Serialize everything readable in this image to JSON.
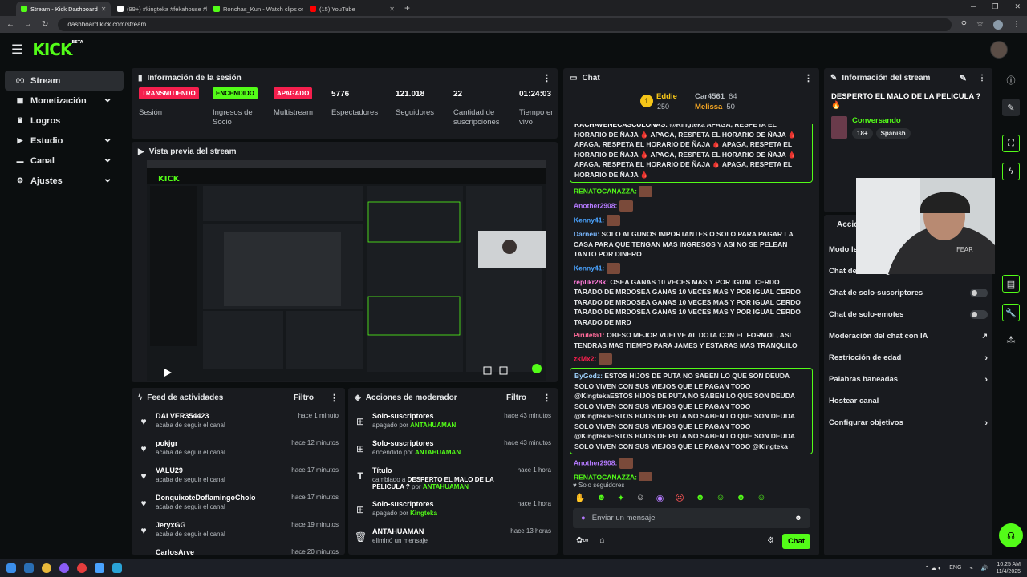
{
  "browser": {
    "tabs": [
      {
        "title": "Stream - Kick Dashboard",
        "color": "#53fc18",
        "active": true
      },
      {
        "title": "(99+) #kingteka #fekahouse #lo",
        "color": "#ffffff",
        "active": false
      },
      {
        "title": "Ronchas_Kun - Watch clips on",
        "color": "#53fc18",
        "active": false
      },
      {
        "title": "(15) YouTube",
        "color": "#ff0000",
        "active": false
      }
    ],
    "url": "dashboard.kick.com/stream"
  },
  "header": {
    "logo": "KICK",
    "logo_badge": "BETA"
  },
  "sidebar": {
    "items": [
      {
        "label": "Stream",
        "icon": "stream-icon",
        "active": true,
        "chevron": false
      },
      {
        "label": "Monetización",
        "icon": "wallet-icon",
        "chevron": true
      },
      {
        "label": "Logros",
        "icon": "trophy-icon",
        "chevron": false
      },
      {
        "label": "Estudio",
        "icon": "studio-icon",
        "chevron": true
      },
      {
        "label": "Canal",
        "icon": "channel-icon",
        "chevron": true
      },
      {
        "label": "Ajustes",
        "icon": "gear-icon",
        "chevron": true
      }
    ]
  },
  "session": {
    "title": "Información de la sesión",
    "stats": [
      {
        "value": "TRANSMITIENDO",
        "label": "Sesión",
        "badge": true,
        "bg": "#f51f4d",
        "fg": "#ffffff"
      },
      {
        "value": "ENCENDIDO",
        "label": "Ingresos de Socio",
        "badge": true,
        "bg": "#53fc18",
        "fg": "#000000"
      },
      {
        "value": "APAGADO",
        "label": "Multistream",
        "badge": true,
        "bg": "#f51f4d",
        "fg": "#ffffff"
      },
      {
        "value": "5776",
        "label": "Espectadores"
      },
      {
        "value": "121.018",
        "label": "Seguidores"
      },
      {
        "value": "22",
        "label": "Cantidad de suscripciones"
      },
      {
        "value": "01:24:03",
        "label": "Tiempo en vivo"
      }
    ]
  },
  "preview": {
    "title": "Vista previa del stream"
  },
  "activity": {
    "title": "Feed de actividades",
    "filter": "Filtro",
    "items": [
      {
        "name": "DALVER354423",
        "action": "acaba de seguir el canal",
        "time": "hace 1 minuto"
      },
      {
        "name": "pokjgr",
        "action": "acaba de seguir el canal",
        "time": "hace 12 minutos"
      },
      {
        "name": "VALU29",
        "action": "acaba de seguir el canal",
        "time": "hace 17 minutos"
      },
      {
        "name": "DonquixoteDoflamingoCholo",
        "action": "acaba de seguir el canal",
        "time": "hace 17 minutos"
      },
      {
        "name": "JeryxGG",
        "action": "acaba de seguir el canal",
        "time": "hace 19 minutos"
      },
      {
        "name": "CarlosArve",
        "action": "",
        "time": "hace 20 minutos"
      }
    ]
  },
  "mod_actions": {
    "title": "Acciones de moderador",
    "filter": "Filtro",
    "items": [
      {
        "icon": "gift-icon",
        "title": "Solo-suscriptores",
        "pre": "apagado por ",
        "user": "ANTAHUAMAN",
        "time": "hace 43 minutos"
      },
      {
        "icon": "gift-icon",
        "title": "Solo-suscriptores",
        "pre": "encendido por ",
        "user": "ANTAHUAMAN",
        "time": "hace 43 minutos"
      },
      {
        "icon": "title-icon",
        "title": "Título",
        "pre": "cambiado a ",
        "bold": "DESPERTO EL MALO DE LA PELICULA ?",
        "post": " por ",
        "user": "ANTAHUAMAN",
        "time": "hace 1 hora"
      },
      {
        "icon": "gift-icon",
        "title": "Solo-suscriptores",
        "pre": "apagado por ",
        "user": "Kingteka",
        "time": "hace 1 hora"
      },
      {
        "icon": "trash-icon",
        "title": "ANTAHUAMAN",
        "pre": "eliminó un mensaje",
        "user": "",
        "time": "hace 13 horas"
      }
    ]
  },
  "chat": {
    "title": "Chat",
    "gifters": [
      {
        "name": "Eddie",
        "count": "250",
        "color": "#f5c518"
      },
      {
        "name": "Car4561",
        "count": "64",
        "color": "#b7bcc1"
      },
      {
        "name": "Melissa",
        "count": "50",
        "color": "#f5a623"
      }
    ],
    "messages": [
      {
        "user": "KACHAVENECASCULONAS:",
        "color": "#ffffff",
        "text": "@Kingteka APAGA, RESPETA EL HORARIO DE ÑAJA 🩸 APAGA, RESPETA EL HORARIO DE ÑAJA 🩸 APAGA, RESPETA EL HORARIO DE ÑAJA 🩸 APAGA, RESPETA EL HORARIO DE ÑAJA 🩸 APAGA, RESPETA EL HORARIO DE ÑAJA 🩸 APAGA, RESPETA EL HORARIO DE ÑAJA 🩸 APAGA, RESPETA EL HORARIO DE ÑAJA 🩸",
        "highlight": true,
        "cut_top": true
      },
      {
        "user": "RENATOCANAZZA:",
        "color": "#53fc18",
        "text": "",
        "emote": true
      },
      {
        "user": "Another2908:",
        "color": "#b57aff",
        "text": "",
        "emote": true
      },
      {
        "user": "Kenny41:",
        "color": "#4aa3ff",
        "text": "",
        "emote": true
      },
      {
        "user": "Darneu:",
        "color": "#7ab8ff",
        "text": "SOLO ALGUNOS IMPORTANTES O SOLO PARA PAGAR LA CASA PARA QUE TENGAN MAS INGRESOS Y ASI NO SE PELEAN TANTO POR DINERO"
      },
      {
        "user": "Kenny41:",
        "color": "#4aa3ff",
        "text": "",
        "emote": true
      },
      {
        "user": "replikr28k:",
        "color": "#ff7ad9",
        "text": "OSEA GANAS 10 VECES MAS Y POR IGUAL CERDO TARADO DE MRDOSEA GANAS 10 VECES MAS Y POR IGUAL CERDO TARADO DE MRDOSEA GANAS 10 VECES MAS Y POR IGUAL CERDO TARADO DE MRDOSEA GANAS 10 VECES MAS Y POR IGUAL CERDO TARADO DE MRD"
      },
      {
        "user": "Piruleta1:",
        "color": "#ff6b9a",
        "text": "OBESO MEJOR VUELVE AL DOTA CON EL FORMOL, ASI TENDRAS MAS TIEMPO PARA JAMES Y ESTARAS MAS TRANQUILO"
      },
      {
        "user": "zkMx2:",
        "color": "#f51f4d",
        "text": "",
        "emote": true
      },
      {
        "user": "ByGodz:",
        "color": "#9fd3ff",
        "text": "ESTOS HIJOS DE PUTA NO SABEN LO QUE SON DEUDA SOLO VIVEN CON SUS VIEJOS QUE LE PAGAN TODO @KingtekaESTOS HIJOS DE PUTA NO SABEN LO QUE SON DEUDA SOLO VIVEN CON SUS VIEJOS QUE LE PAGAN TODO @KingtekaESTOS HIJOS DE PUTA NO SABEN LO QUE SON DEUDA SOLO VIVEN CON SUS VIEJOS QUE LE PAGAN TODO @KingtekaESTOS HIJOS DE PUTA NO SABEN LO QUE SON DEUDA SOLO VIVEN CON SUS VIEJOS QUE LE PAGAN TODO @Kingteka",
        "highlight": true
      },
      {
        "user": "Another2908:",
        "color": "#b57aff",
        "text": "",
        "emote": true
      },
      {
        "user": "RENATOCANAZZA:",
        "color": "#53fc18",
        "text": "",
        "emote": true
      }
    ],
    "followers_only": "Solo seguidores",
    "input_placeholder": "Enviar un mensaje",
    "send_label": "Chat"
  },
  "stream_info": {
    "title": "Información del stream",
    "stream_title": "DESPERTO EL MALO DE LA PELICULA ? 🔥",
    "category": "Conversando",
    "tags": [
      "18+",
      "Spanish"
    ]
  },
  "actions": {
    "title": "Acciones",
    "items": [
      {
        "label": "Modo lento",
        "type": "none"
      },
      {
        "label": "Chat de solo-seguidores",
        "type": "none"
      },
      {
        "label": "Chat de solo-suscriptores",
        "type": "toggle"
      },
      {
        "label": "Chat de solo-emotes",
        "type": "toggle"
      },
      {
        "label": "Moderación del chat con IA",
        "type": "external"
      },
      {
        "label": "Restricción de edad",
        "type": "chevron"
      },
      {
        "label": "Palabras baneadas",
        "type": "chevron"
      },
      {
        "label": "Hostear canal",
        "type": "none"
      },
      {
        "label": "Configurar objetivos",
        "type": "chevron"
      }
    ]
  },
  "taskbar": {
    "lang": "ENG",
    "time": "10:25 AM",
    "date": "11/4/2025"
  },
  "colors": {
    "accent": "#53fc18",
    "live": "#f51f4d",
    "panel": "#191b1f",
    "bg": "#0b0e0f"
  }
}
